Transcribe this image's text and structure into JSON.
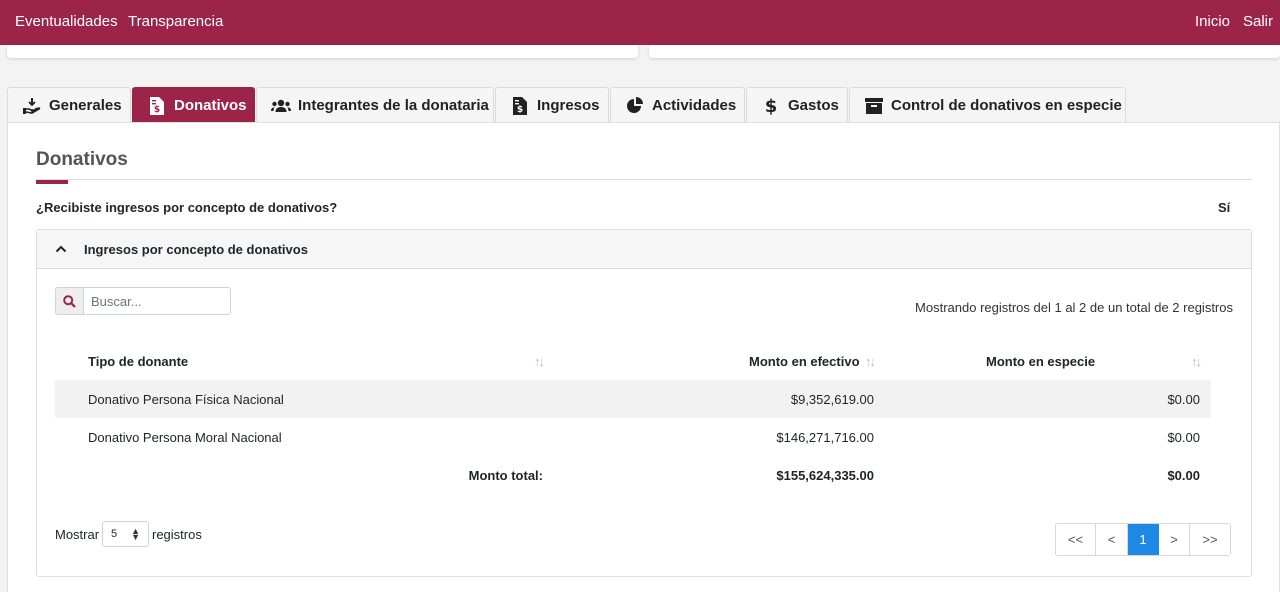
{
  "topnav": {
    "left_links": [
      "Eventualidades",
      "Transparencia"
    ],
    "right_links": [
      "Inicio",
      "Salir"
    ],
    "color": "#9d2449"
  },
  "tabs": [
    {
      "label": "Generales",
      "icon": "hand-holding-dollar-icon"
    },
    {
      "label": "Donativos",
      "icon": "file-invoice-dollar-icon",
      "active": true
    },
    {
      "label": "Integrantes de la donataria",
      "icon": "users-icon"
    },
    {
      "label": "Ingresos",
      "icon": "file-invoice-dollar-icon"
    },
    {
      "label": "Actividades",
      "icon": "chart-pie-icon"
    },
    {
      "label": "Gastos",
      "icon": "dollar-sign-icon"
    },
    {
      "label": "Control de donativos en especie",
      "icon": "archive-icon"
    }
  ],
  "section": {
    "title": "Donativos",
    "question": "¿Recibiste ingresos por concepto de donativos?",
    "answer": "Sí"
  },
  "accordion": {
    "title": "Ingresos por concepto de donativos",
    "expanded": true,
    "search": {
      "placeholder": "Buscar...",
      "value": ""
    },
    "records_info": "Mostrando registros del 1 al 2 de un total de 2 registros",
    "table": {
      "columns": [
        "Tipo de donante",
        "Monto en efectivo",
        "Monto en especie"
      ],
      "rows": [
        [
          "Donativo Persona Física Nacional",
          "$9,352,619.00",
          "$0.00"
        ],
        [
          "Donativo Persona Moral Nacional",
          "$146,271,716.00",
          "$0.00"
        ]
      ],
      "total": {
        "label": "Monto total:",
        "efectivo": "$155,624,335.00",
        "especie": "$0.00"
      }
    },
    "page_size": {
      "prefix": "Mostrar",
      "value": "5",
      "suffix": "registros"
    },
    "pagination": [
      "<<",
      "<",
      "1",
      ">",
      ">>"
    ],
    "current_page": "1"
  }
}
